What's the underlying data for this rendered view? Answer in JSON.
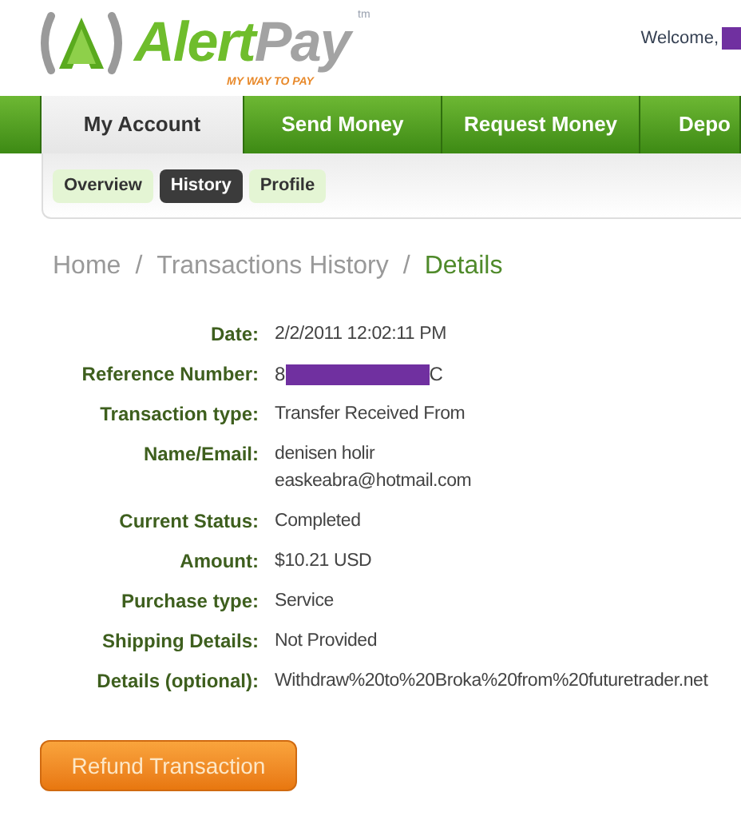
{
  "header": {
    "logo": {
      "word_1": "Alert",
      "word_2": "Pay",
      "trademark": "tm",
      "tagline": "MY WAY TO PAY"
    },
    "welcome": "Welcome,"
  },
  "nav_tabs": [
    {
      "label": "My Account",
      "selected": true
    },
    {
      "label": "Send Money",
      "selected": false
    },
    {
      "label": "Request Money",
      "selected": false
    },
    {
      "label": "Depo",
      "selected": false
    }
  ],
  "sub_tabs": [
    {
      "label": "Overview",
      "selected": false
    },
    {
      "label": "History",
      "selected": true
    },
    {
      "label": "Profile",
      "selected": false
    }
  ],
  "breadcrumb": [
    "Home",
    "Transactions History",
    "Details"
  ],
  "breadcrumb_separator": "/",
  "details": [
    {
      "label": "Date:",
      "values": [
        "2/2/2011 12:02:11 PM"
      ]
    },
    {
      "label": "Reference Number:",
      "kind": "redacted",
      "values": [
        "8",
        "C"
      ]
    },
    {
      "label": "Transaction type:",
      "values": [
        "Transfer Received From"
      ]
    },
    {
      "label": "Name/Email:",
      "values": [
        "denisen holir",
        "easkeabra@hotmail.com"
      ]
    },
    {
      "label": "Current Status:",
      "values": [
        "Completed"
      ]
    },
    {
      "label": "Amount:",
      "values": [
        "$10.21 USD"
      ]
    },
    {
      "label": "Purchase type:",
      "values": [
        "Service"
      ]
    },
    {
      "label": "Shipping Details:",
      "values": [
        "Not Provided"
      ]
    },
    {
      "label": "Details (optional):",
      "values": [
        "Withdraw%20to%20Broka%20from%20futuretrader.net"
      ]
    }
  ],
  "refund_button": "Refund Transaction"
}
